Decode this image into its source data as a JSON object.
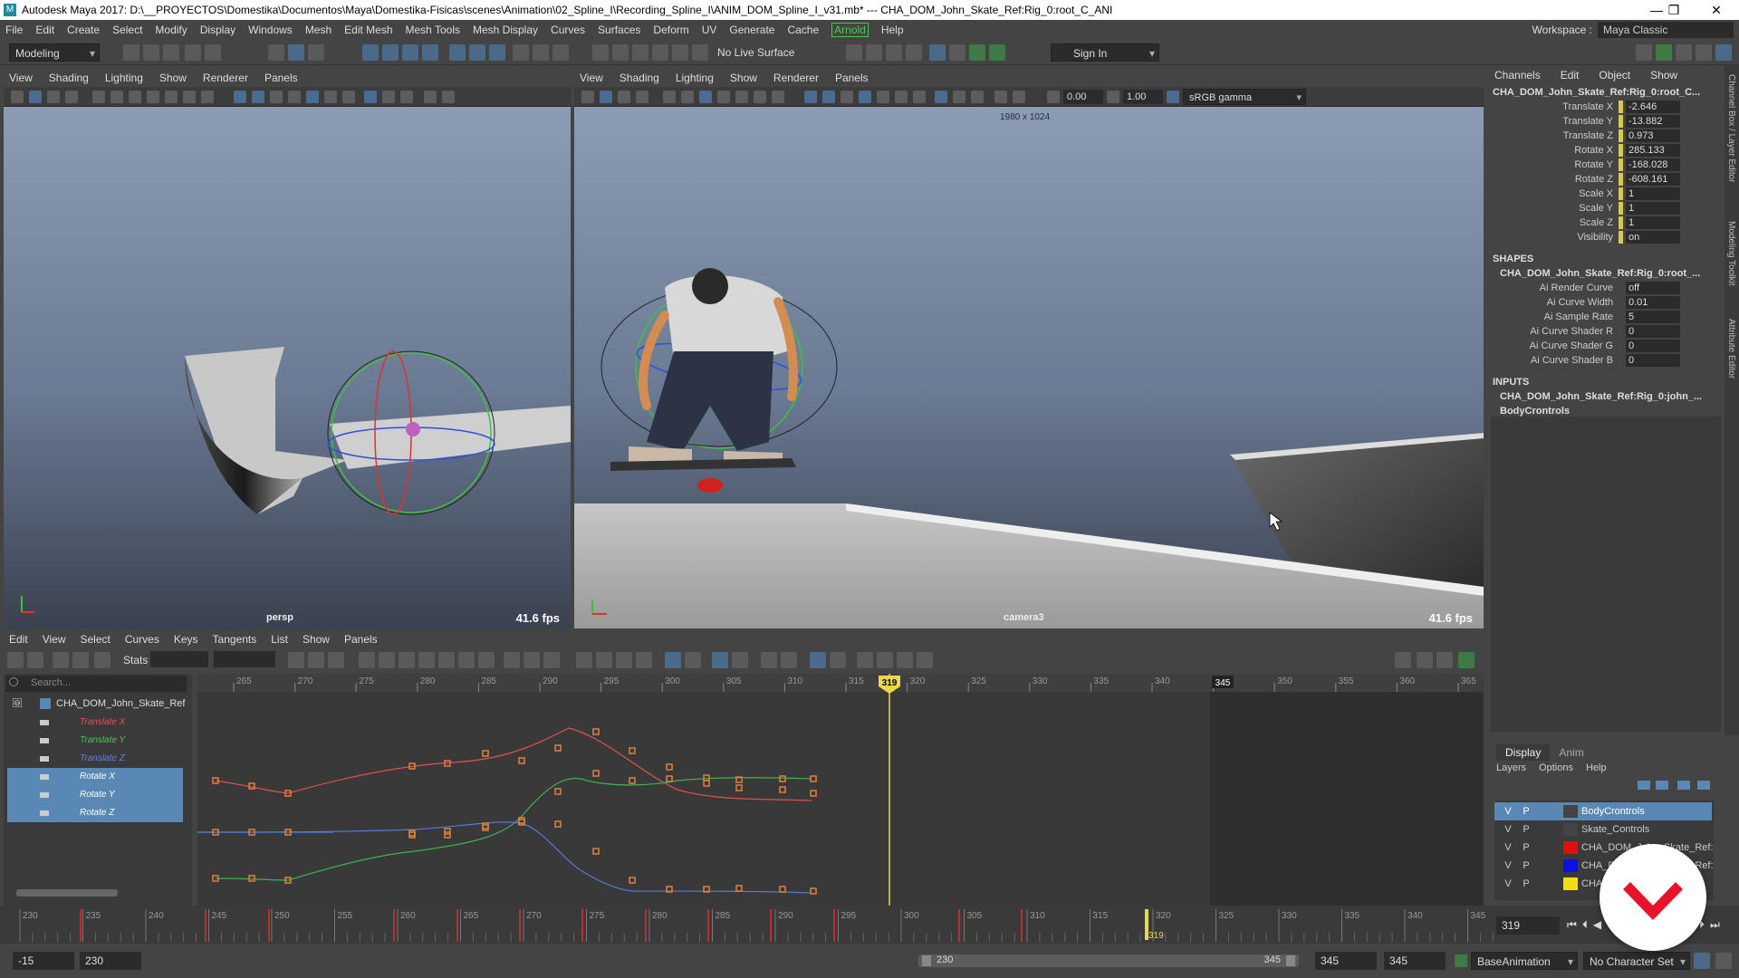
{
  "title_bar": {
    "title": "Autodesk Maya 2017: D:\\__PROYECTOS\\Domestika\\Documentos\\Maya\\Domestika-Fisicas\\scenes\\Animation\\02_Spline_I\\Recording_Spline_I\\ANIM_DOM_Spline_I_v31.mb*   ---   CHA_DOM_John_Skate_Ref:Rig_0:root_C_ANI",
    "minimize": "—",
    "maximize": "❐",
    "close": "✕"
  },
  "menu": [
    "File",
    "Edit",
    "Create",
    "Select",
    "Modify",
    "Display",
    "Windows",
    "Mesh",
    "Edit Mesh",
    "Mesh Tools",
    "Mesh Display",
    "Curves",
    "Surfaces",
    "Deform",
    "UV",
    "Generate",
    "Cache"
  ],
  "menu_arnold": "Arnold",
  "menu_help": "Help",
  "workspace": {
    "label": "Workspace :",
    "value": "Maya Classic"
  },
  "toolbar": {
    "mode": "Modeling",
    "live_surface": "No Live Surface",
    "sign_in": "Sign In"
  },
  "viewport_left": {
    "menu": [
      "View",
      "Shading",
      "Lighting",
      "Show",
      "Renderer",
      "Panels"
    ],
    "camera": "persp",
    "fps": "41.6 fps"
  },
  "viewport_right": {
    "menu": [
      "View",
      "Shading",
      "Lighting",
      "Show",
      "Renderer",
      "Panels"
    ],
    "camera": "camera3",
    "fps": "41.6 fps",
    "resolution": "1980 x 1024",
    "exposure": "0.00",
    "gamma": "1.00",
    "color_space": "sRGB gamma"
  },
  "channel_box": {
    "menu": [
      "Channels",
      "Edit",
      "Object",
      "Show"
    ],
    "object": "CHA_DOM_John_Skate_Ref:Rig_0:root_C...",
    "channels": [
      {
        "name": "Translate X",
        "value": "-2.646"
      },
      {
        "name": "Translate Y",
        "value": "-13.882"
      },
      {
        "name": "Translate Z",
        "value": "0.973"
      },
      {
        "name": "Rotate X",
        "value": "285.133"
      },
      {
        "name": "Rotate Y",
        "value": "-168.028"
      },
      {
        "name": "Rotate Z",
        "value": "-608.161"
      },
      {
        "name": "Scale X",
        "value": "1"
      },
      {
        "name": "Scale Y",
        "value": "1"
      },
      {
        "name": "Scale Z",
        "value": "1"
      },
      {
        "name": "Visibility",
        "value": "on"
      }
    ],
    "shapes_header": "SHAPES",
    "shape_name": "CHA_DOM_John_Skate_Ref:Rig_0:root_...",
    "shape_attrs": [
      {
        "name": "Ai Render Curve",
        "value": "off"
      },
      {
        "name": "Ai Curve Width",
        "value": "0.01"
      },
      {
        "name": "Ai Sample Rate",
        "value": "5"
      },
      {
        "name": "Ai Curve Shader R",
        "value": "0"
      },
      {
        "name": "Ai Curve Shader G",
        "value": "0"
      },
      {
        "name": "Ai Curve Shader B",
        "value": "0"
      }
    ],
    "inputs_header": "INPUTS",
    "inputs": [
      "CHA_DOM_John_Skate_Ref:Rig_0:john_...",
      "BodyCrontrols"
    ]
  },
  "side_tabs": [
    "Channel Box / Layer Editor",
    "Modeling Toolkit",
    "Attribute Editor"
  ],
  "graph_editor": {
    "menu": [
      "Edit",
      "View",
      "Select",
      "Curves",
      "Keys",
      "Tangents",
      "List",
      "Show",
      "Panels"
    ],
    "stats_label": "Stats",
    "search_placeholder": "Search...",
    "outliner_root": "CHA_DOM_John_Skate_Ref",
    "channels": [
      {
        "name": "Translate X",
        "selected": false,
        "color": "#e05050"
      },
      {
        "name": "Translate Y",
        "selected": false,
        "color": "#50c050"
      },
      {
        "name": "Translate Z",
        "selected": false,
        "color": "#6080e0"
      },
      {
        "name": "Rotate X",
        "selected": true,
        "color": "#ffffff"
      },
      {
        "name": "Rotate Y",
        "selected": true,
        "color": "#ffffff"
      },
      {
        "name": "Rotate Z",
        "selected": true,
        "color": "#ffffff"
      }
    ],
    "ruler_labels": [
      "265",
      "270",
      "275",
      "280",
      "285",
      "290",
      "295",
      "300",
      "305",
      "310",
      "315",
      "320",
      "325",
      "330",
      "335",
      "340",
      "345",
      "350",
      "355",
      "360",
      "365"
    ],
    "current_frame": "319",
    "end_marker": "345"
  },
  "timeline": {
    "labels": [
      "230",
      "235",
      "240",
      "245",
      "250",
      "255",
      "260",
      "265",
      "270",
      "275",
      "280",
      "285",
      "290",
      "295",
      "300",
      "305",
      "310",
      "315",
      "320",
      "325",
      "330",
      "335",
      "340",
      "345"
    ],
    "current_frame": "319",
    "frame_field": "319"
  },
  "range_bar": {
    "start_anim": "-15",
    "start": "230",
    "range_start": "230",
    "range_end": "345",
    "end": "345",
    "end_anim": "345",
    "anim_layer": "BaseAnimation",
    "char_set": "No Character Set"
  },
  "layer_editor": {
    "tabs": [
      "Display",
      "Anim"
    ],
    "menu": [
      "Layers",
      "Options",
      "Help"
    ],
    "layers": [
      {
        "v": "V",
        "p": "P",
        "name": "BodyCrontrols",
        "color": "#444444",
        "selected": true
      },
      {
        "v": "V",
        "p": "P",
        "name": "Skate_Controls",
        "color": "#444444",
        "selected": false
      },
      {
        "v": "V",
        "p": "P",
        "name": "CHA_DOM_John_Skate_Ref:",
        "color": "#e01010",
        "selected": false
      },
      {
        "v": "V",
        "p": "P",
        "name": "CHA_DOM_John_Skate_Ref:",
        "color": "#1010e0",
        "selected": false
      },
      {
        "v": "V",
        "p": "P",
        "name": "CHA_DOM",
        "color": "#f0e010",
        "selected": false
      }
    ]
  },
  "colors": {
    "accent": "#5a88b4",
    "current_time": "#e8d84a",
    "curve_x": "#e05050",
    "curve_y": "#50c050",
    "curve_z": "#6080e0",
    "key": "#e0803a"
  }
}
